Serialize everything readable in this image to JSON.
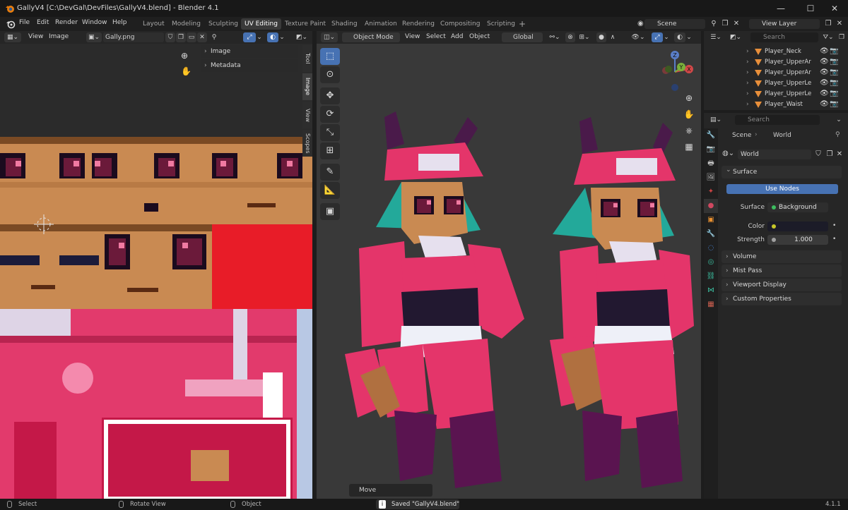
{
  "window": {
    "title": "GallyV4 [C:\\DevGal\\DevFiles\\GallyV4.blend] - Blender 4.1",
    "controls": [
      "—",
      "☐",
      "✕"
    ]
  },
  "menu": [
    "File",
    "Edit",
    "Render",
    "Window",
    "Help"
  ],
  "workspaces": {
    "tabs": [
      "Layout",
      "Modeling",
      "Sculpting",
      "UV Editing",
      "Texture Paint",
      "Shading",
      "Animation",
      "Rendering",
      "Compositing",
      "Scripting"
    ],
    "active": "UV Editing",
    "add": "+"
  },
  "scene_selector": {
    "value": "Scene"
  },
  "view_layer_selector": {
    "value": "View Layer"
  },
  "image_editor": {
    "header": {
      "view": "View",
      "image": "Image",
      "image_name": "Gally.png"
    },
    "sidebar_panels": [
      "Image",
      "Metadata"
    ],
    "sidebar_tabs": [
      "Tool",
      "Image",
      "View",
      "Scopes"
    ],
    "active_tab": "Image"
  },
  "viewport": {
    "header": {
      "mode": "Object Mode",
      "view": "View",
      "select": "Select",
      "add": "Add",
      "object": "Object",
      "orientation": "Global"
    },
    "last_operator": "Move",
    "gizmo_axes": [
      "Z",
      "Y",
      "X"
    ]
  },
  "outliner": {
    "search_placeholder": "Search",
    "rows": [
      "Player_Neck",
      "Player_UpperArm",
      "Player_UpperArm",
      "Player_UpperLeg",
      "Player_UpperLeg",
      "Player_Waist"
    ]
  },
  "properties": {
    "search_placeholder": "Search",
    "breadcrumb": [
      "Scene",
      "World"
    ],
    "world_name": "World",
    "panels": {
      "surface": "Surface",
      "use_nodes": "Use Nodes",
      "surface_label": "Surface",
      "surface_value": "Background",
      "color_label": "Color",
      "strength_label": "Strength",
      "strength_value": "1.000",
      "collapsed": [
        "Volume",
        "Mist Pass",
        "Viewport Display",
        "Custom Properties"
      ]
    }
  },
  "statusbar": {
    "select": "Select",
    "rotate_view": "Rotate View",
    "object": "Object",
    "message": "Saved \"GallyV4.blend\"",
    "version": "4.1.1"
  },
  "colors": {
    "accent": "#4772b3",
    "texture_skin": "#c98a52",
    "texture_pink": "#e23a6c",
    "texture_red": "#e81c28",
    "char_pink": "#e4356a",
    "char_hair": "#23a99a",
    "char_boots": "#5a1450"
  }
}
